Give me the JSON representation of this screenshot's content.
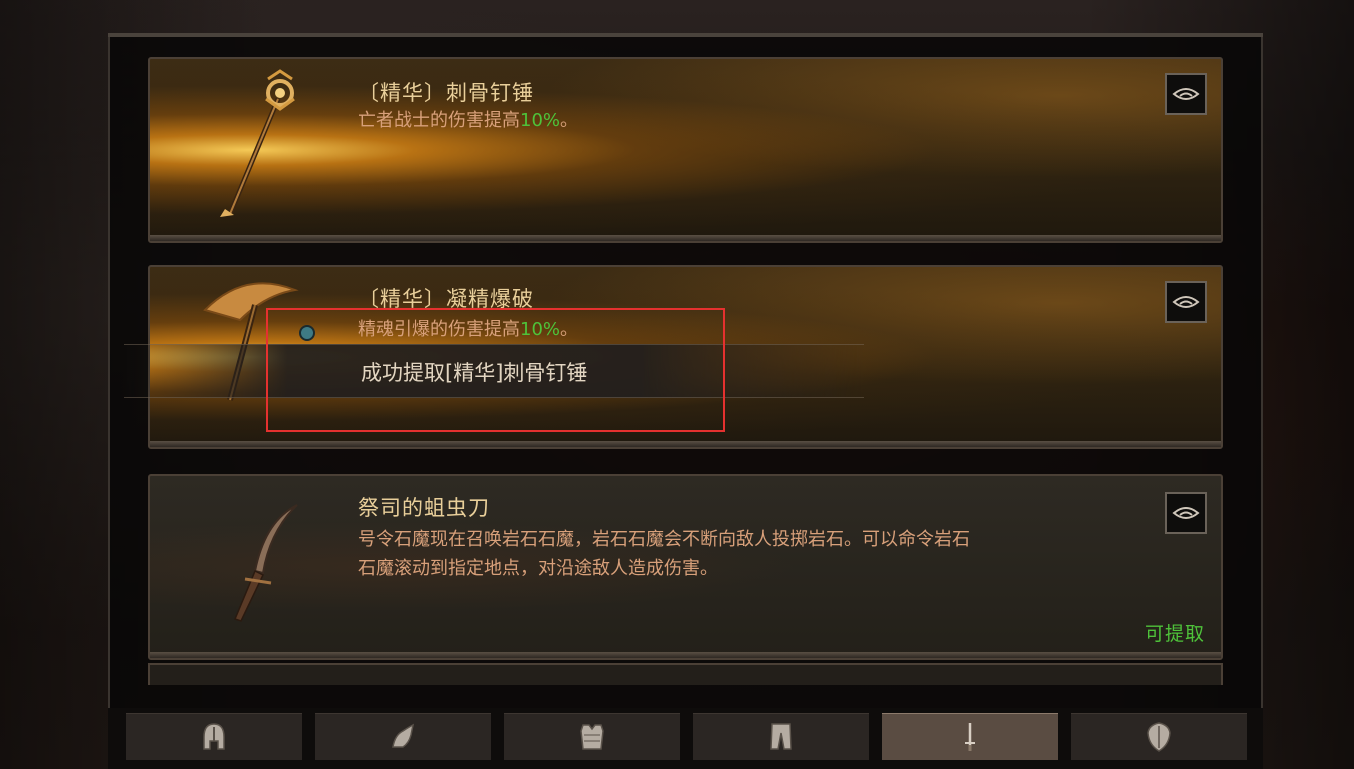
{
  "cards": [
    {
      "title": "〔精华〕刺骨钉锤",
      "desc_prefix": "亡者战士的伤害提高",
      "desc_value": "10%",
      "desc_suffix": "。"
    },
    {
      "title": "〔精华〕凝精爆破",
      "desc_prefix": "精魂引爆的伤害提高",
      "desc_value": "10%",
      "desc_suffix": "。"
    },
    {
      "title": "祭司的蛆虫刀",
      "desc_line1": "号令石魔现在召唤岩石石魔，岩石石魔会不断向敌人投掷岩石。可以命令岩石",
      "desc_line2": "石魔滚动到指定地点，对沿途敌人造成伤害。",
      "status": "可提取"
    }
  ],
  "toast": {
    "text": "成功提取[精华]刺骨钉锤"
  },
  "tabs": [
    {
      "icon": "helmet-icon"
    },
    {
      "icon": "gloves-icon"
    },
    {
      "icon": "chest-armor-icon"
    },
    {
      "icon": "pants-icon"
    },
    {
      "icon": "weapon-icon",
      "active": true
    },
    {
      "icon": "shield-icon"
    }
  ],
  "colors": {
    "accent_green": "#4ec23a",
    "title_gold": "#e9cf9a",
    "desc_orange": "#d8a07a",
    "highlight_red": "#e5312f"
  }
}
